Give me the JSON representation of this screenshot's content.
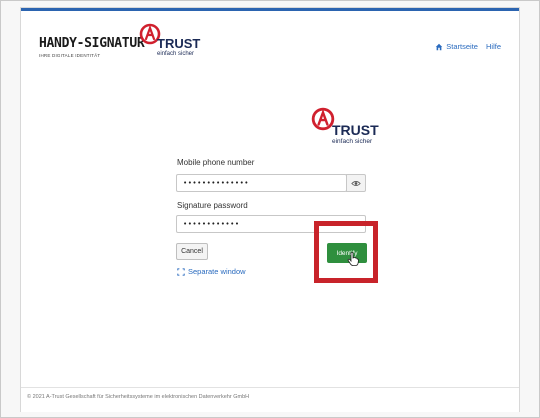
{
  "header": {
    "brand_title": "HANDY-SIGNATUR",
    "brand_subtitle": "IHRE DIGITALE IDENTITÄT",
    "logo_text": "TRUST",
    "logo_tagline": "einfach sicher",
    "nav": {
      "home_label": "Startseite",
      "help_label": "Hilfe"
    }
  },
  "center_logo": {
    "text": "TRUST",
    "tagline": "einfach sicher"
  },
  "form": {
    "phone_label": "Mobile phone number",
    "phone_value": "••••••••••••••",
    "password_label": "Signature password",
    "password_value": "••••••••••••",
    "cancel_label": "Cancel",
    "identify_label": "Identify",
    "separate_window_label": "Separate window"
  },
  "footer": {
    "text": "© 2021 A-Trust Gesellschaft für Sicherheitssysteme im elektronischen Datenverkehr GmbH"
  },
  "colors": {
    "accent_blue": "#2b64b0",
    "link_blue": "#2a6bbf",
    "identify_green": "#2f8f3e",
    "highlight_red": "#c8232a",
    "logo_red": "#d0202e",
    "logo_navy": "#1b2a55"
  }
}
